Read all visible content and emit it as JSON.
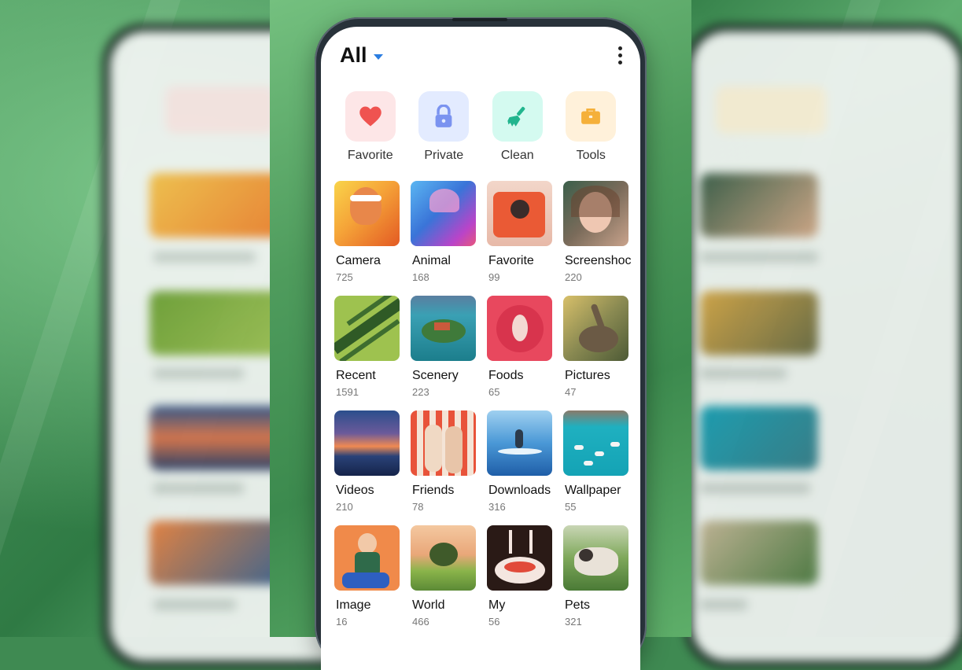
{
  "header": {
    "title": "All"
  },
  "quick_actions": [
    {
      "label": "Favorite",
      "icon": "heart-icon",
      "bg": "#fde6e7",
      "fg": "#ef5350"
    },
    {
      "label": "Private",
      "icon": "lock-icon",
      "bg": "#e3ebff",
      "fg": "#7b93f0"
    },
    {
      "label": "Clean",
      "icon": "broom-icon",
      "bg": "#d4faf0",
      "fg": "#22b58e"
    },
    {
      "label": "Tools",
      "icon": "toolbox-icon",
      "bg": "#fff1da",
      "fg": "#f5b03a"
    }
  ],
  "albums": [
    {
      "name": "Camera",
      "count": "725"
    },
    {
      "name": "Animal",
      "count": "168"
    },
    {
      "name": "Favorite",
      "count": "99"
    },
    {
      "name": "Screenshoc",
      "count": "220"
    },
    {
      "name": "Recent",
      "count": "1591"
    },
    {
      "name": "Scenery",
      "count": "223"
    },
    {
      "name": "Foods",
      "count": "65"
    },
    {
      "name": "Pictures",
      "count": "47"
    },
    {
      "name": "Videos",
      "count": "210"
    },
    {
      "name": "Friends",
      "count": "78"
    },
    {
      "name": "Downloads",
      "count": "316"
    },
    {
      "name": "Wallpaper",
      "count": "55"
    },
    {
      "name": "Image",
      "count": "16"
    },
    {
      "name": "World",
      "count": "466"
    },
    {
      "name": "My",
      "count": "56"
    },
    {
      "name": "Pets",
      "count": "321"
    }
  ],
  "colors": {
    "accent": "#2a7de1"
  }
}
